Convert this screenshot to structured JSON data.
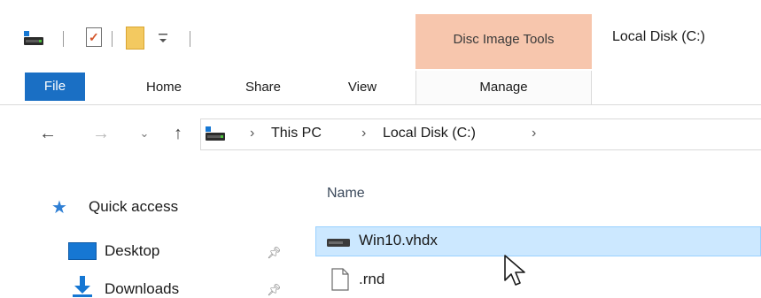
{
  "quick_access_toolbar": {
    "items": [
      "drive-icon",
      "properties-icon",
      "new-folder-icon",
      "customize-dropdown-icon"
    ]
  },
  "context_tab": {
    "title": "Disc Image Tools",
    "color": "#f7c6ad"
  },
  "window": {
    "title": "Local Disk (C:)"
  },
  "ribbon_tabs": {
    "file": "File",
    "home": "Home",
    "share": "Share",
    "view": "View",
    "manage": "Manage"
  },
  "address_bar": {
    "breadcrumbs": [
      "This PC",
      "Local Disk (C:)"
    ]
  },
  "nav_pane": {
    "items": [
      {
        "label": "Quick access",
        "icon": "star-icon"
      },
      {
        "label": "Desktop",
        "icon": "desktop-icon",
        "pinned": true
      },
      {
        "label": "Downloads",
        "icon": "downloads-icon",
        "pinned": true
      }
    ]
  },
  "file_list": {
    "column_header": "Name",
    "files": [
      {
        "name": "Win10.vhdx",
        "icon": "virtual-disk-icon",
        "selected": true
      },
      {
        "name": ".rnd",
        "icon": "file-icon",
        "selected": false
      }
    ]
  },
  "colors": {
    "accent": "#1a6fc4",
    "selection": "#cce8ff",
    "selection_border": "#99d1ff"
  }
}
